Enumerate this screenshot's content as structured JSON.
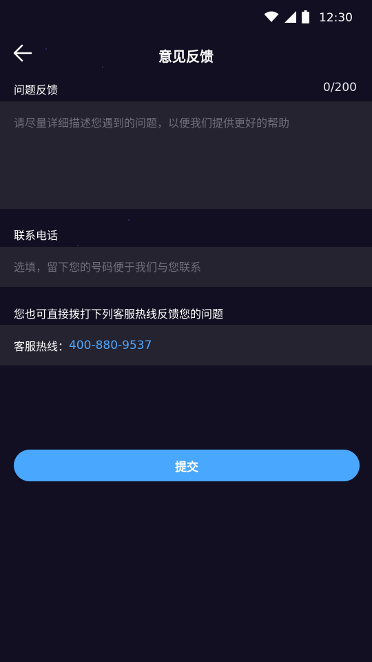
{
  "status_bar": {
    "time": "12:30",
    "icons": [
      "wifi-icon",
      "cellular-signal-icon",
      "battery-icon"
    ]
  },
  "nav": {
    "title": "意见反馈",
    "back_icon": "arrow-left-icon"
  },
  "feedback": {
    "label": "问题反馈",
    "counter": "0/200",
    "value": "",
    "placeholder": "请尽量详细描述您遇到的问题，以便我们提供更好的帮助"
  },
  "phone": {
    "label": "联系电话",
    "value": "",
    "placeholder": "选填，留下您的号码便于我们与您联系"
  },
  "hotline": {
    "hint": "您也可直接拨打下列客服热线反馈您的问题",
    "label": "客服热线：",
    "number": "400-880-9537"
  },
  "submit": {
    "label": "提交"
  },
  "colors": {
    "background": "#110f21",
    "field_background": "#24232f",
    "accent": "#49a7fd",
    "link": "#4da6ff",
    "placeholder": "#6f6e7a"
  }
}
